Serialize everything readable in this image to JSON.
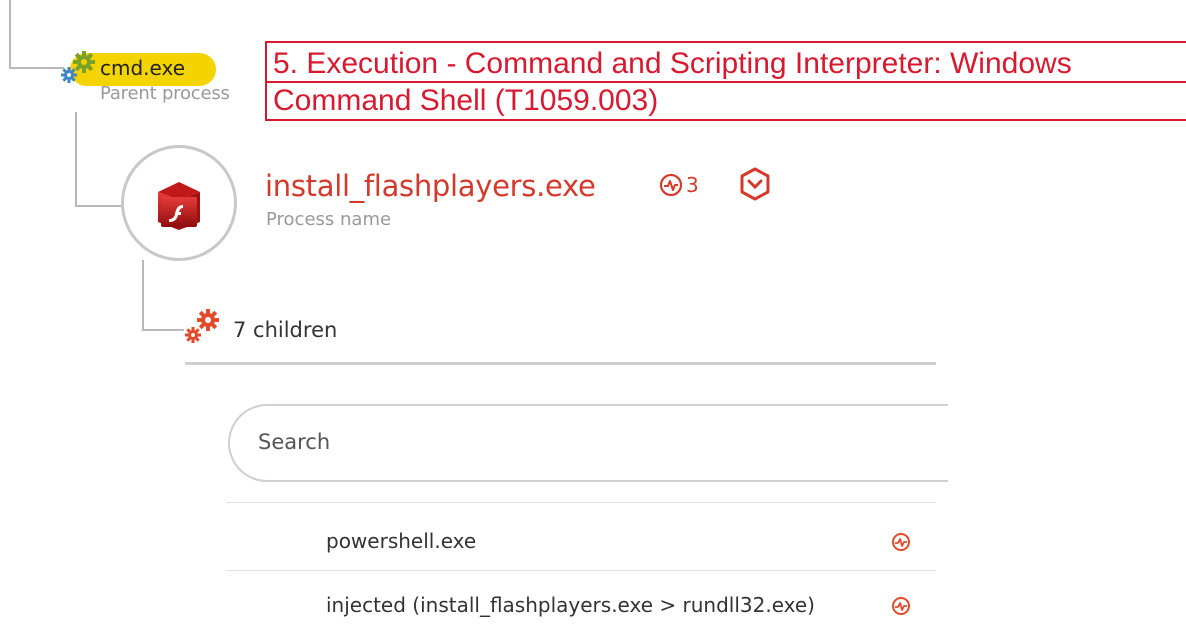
{
  "parent": {
    "name": "cmd.exe",
    "subtitle": "Parent process",
    "icon": "gears-icon",
    "highlight_color": "#f4d400"
  },
  "annotation": {
    "line1": "5. Execution - Command and Scripting Interpreter: Windows",
    "line2": "Command Shell (T1059.003)",
    "color": "#d8192f"
  },
  "process": {
    "name": "install_flashplayers.exe",
    "subtitle": "Process name",
    "alert_count": "3",
    "icon": "flash-box-icon",
    "accent_color": "#d43a2c"
  },
  "children": {
    "label": "7 children",
    "icon": "gears-red-icon"
  },
  "panel": {
    "search_placeholder": "Search",
    "rows": [
      {
        "label": "powershell.exe",
        "icon": "alert-icon"
      },
      {
        "label": "injected (install_flashplayers.exe > rundll32.exe)",
        "icon": "alert-icon"
      }
    ]
  }
}
